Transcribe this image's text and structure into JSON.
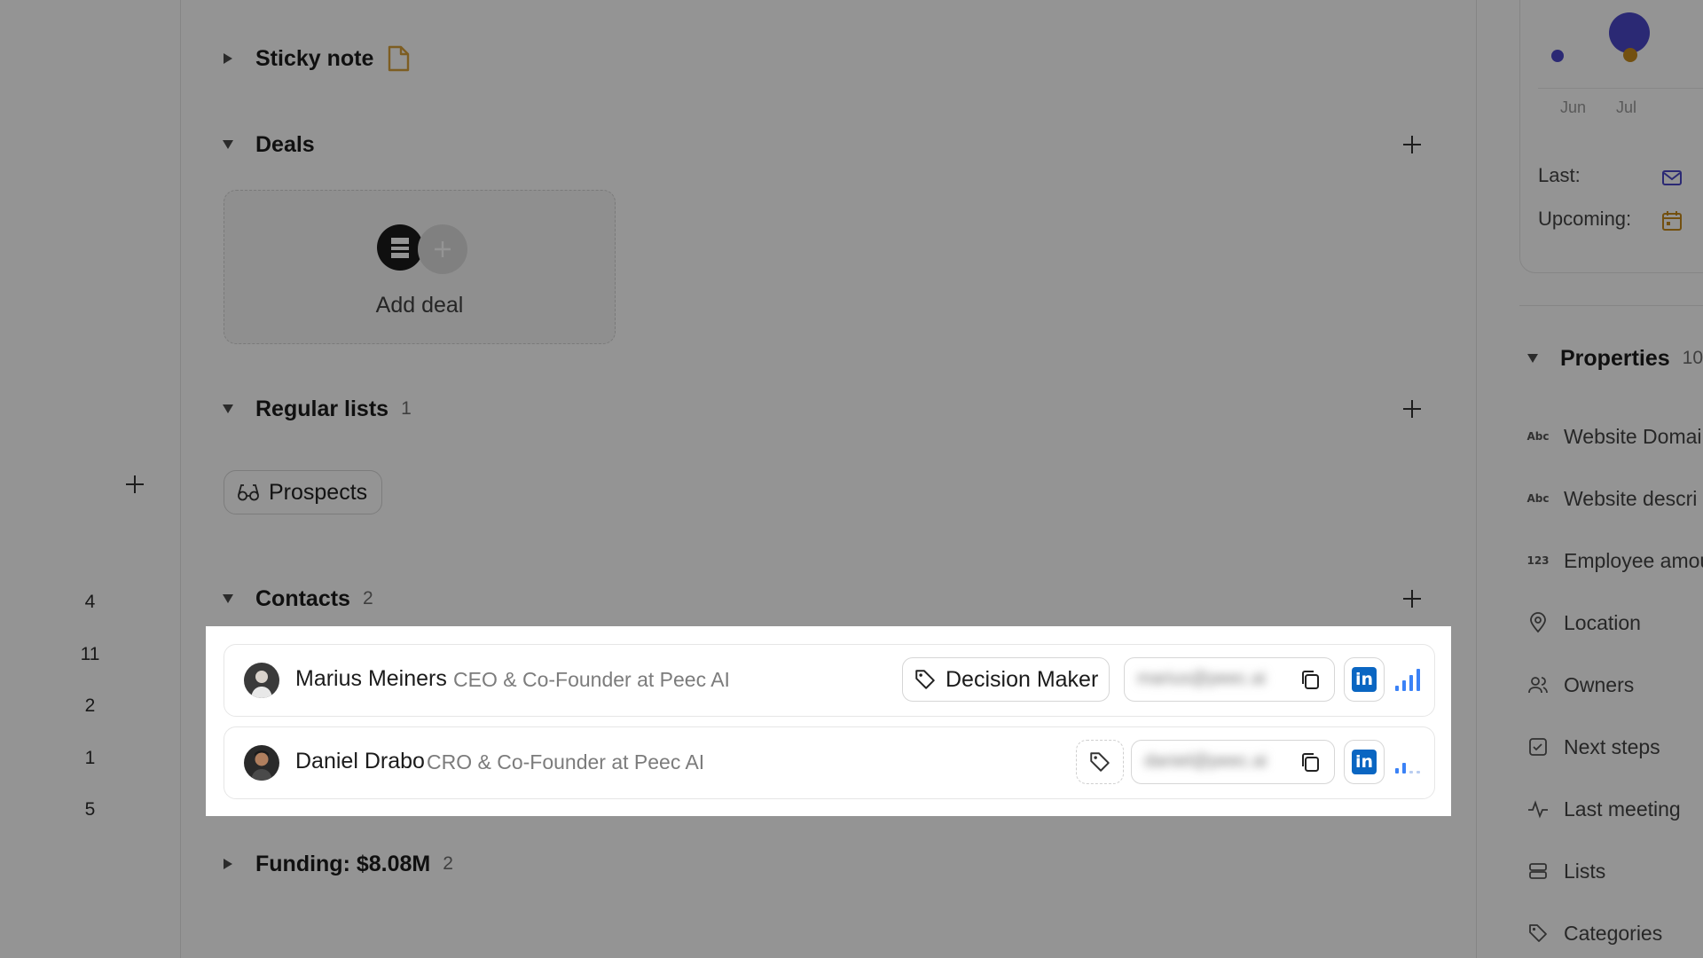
{
  "gutter": {
    "numbers": [
      "4",
      "11",
      "2",
      "1",
      "5"
    ]
  },
  "sections": {
    "sticky_note": {
      "title": "Sticky note"
    },
    "deals": {
      "title": "Deals",
      "add_deal_label": "Add deal"
    },
    "regular_lists": {
      "title": "Regular lists",
      "count": "1",
      "list_chip": "Prospects"
    },
    "contacts": {
      "title": "Contacts",
      "count": "2",
      "items": [
        {
          "name": "Marius Meiners",
          "title": "CEO & Co-Founder at Peec AI",
          "tag": "Decision Maker",
          "email": "marius@peec.ai"
        },
        {
          "name": "Daniel Drabo",
          "title": "CRO & Co-Founder at Peec AI",
          "tag": "",
          "email": "daniel@peec.ai"
        }
      ]
    },
    "funding": {
      "title": "Funding: $8.08M",
      "count": "2"
    }
  },
  "sidebar": {
    "activity": {
      "months": [
        "Jun",
        "Jul"
      ],
      "last_label": "Last:",
      "upcoming_label": "Upcoming:",
      "colors": {
        "dot": "#4a48c8",
        "accent": "#c68a1d"
      }
    },
    "properties": {
      "title": "Properties",
      "count": "10",
      "items": [
        {
          "label": "Website Domai",
          "icon": "abc-icon"
        },
        {
          "label": "Website descri",
          "icon": "abc-icon"
        },
        {
          "label": "Employee amou",
          "icon": "number-icon"
        },
        {
          "label": "Location",
          "icon": "location-pin-icon"
        },
        {
          "label": "Owners",
          "icon": "users-icon"
        },
        {
          "label": "Next steps",
          "icon": "checkbox-icon"
        },
        {
          "label": "Last meeting",
          "icon": "pulse-icon"
        },
        {
          "label": "Lists",
          "icon": "list-stack-icon"
        },
        {
          "label": "Categories",
          "icon": "tag-icon"
        }
      ]
    }
  },
  "colors": {
    "linkedin": "#0a66c2",
    "signal": "#3b82f6",
    "note": "#d8a13b"
  }
}
